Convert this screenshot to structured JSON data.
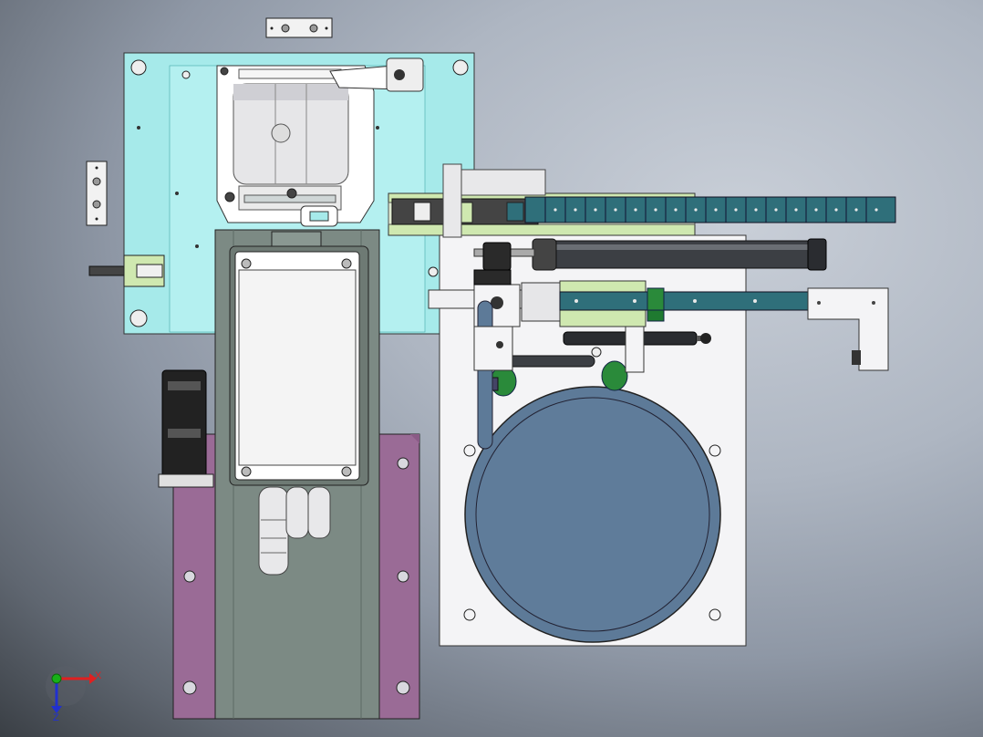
{
  "view": {
    "axes": {
      "x_label": "X",
      "z_label": "Z"
    },
    "colors": {
      "cyan_plate": "#a6eaea",
      "purple_plate": "#9a6b96",
      "grey_frame": "#7c8a84",
      "white_plate": "#f4f4f6",
      "round_tank": "#5d7a98",
      "teal_chain": "#2f6f7a",
      "light_green": "#cfe8b0",
      "dark_bar": "#3c3f44",
      "axis_x": "#e02020",
      "axis_y": "#18b018",
      "axis_z": "#2030d0"
    }
  }
}
